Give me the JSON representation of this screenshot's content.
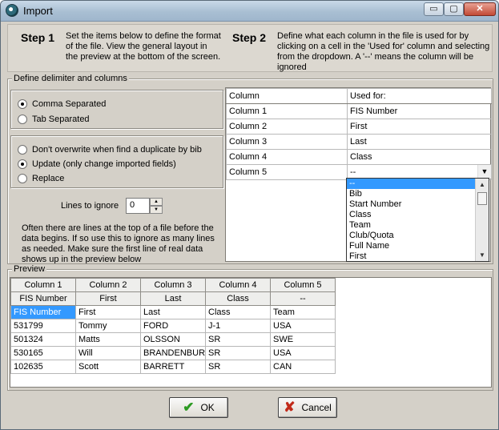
{
  "window": {
    "title": "Import"
  },
  "titlebar_controls": {
    "minimize": "▭",
    "maximize": "▢",
    "close": "✕"
  },
  "steps": {
    "step1_title": "Step 1",
    "step1_desc": "Set the items below to define the format of the file. View the general layout in the preview at the bottom of the screen.",
    "step2_title": "Step 2",
    "step2_desc": "Define what each column in the file is used for by clicking on a cell in the 'Used for' column and selecting from the dropdown. A '--' means the column will be ignored"
  },
  "delimiter": {
    "group_label": "Define delimiter and columns",
    "options": [
      {
        "label": "Comma Separated",
        "checked": true
      },
      {
        "label": "Tab Separated",
        "checked": false
      }
    ],
    "duplicate_options": [
      {
        "label": "Don't overwrite when find a duplicate by bib",
        "checked": false
      },
      {
        "label": "Update (only change imported fields)",
        "checked": true
      },
      {
        "label": "Replace",
        "checked": false
      }
    ],
    "lines_to_ignore_label": "Lines to ignore",
    "lines_to_ignore_value": "0",
    "help_text": "Often there are lines at the top of a file before the data begins. If so use this to ignore as many lines as needed. Make sure the first line of real data shows up in the preview below"
  },
  "mapping": {
    "headers": [
      "Column",
      "Used for:"
    ],
    "rows": [
      {
        "column": "Column 1",
        "used_for": "FIS Number"
      },
      {
        "column": "Column 2",
        "used_for": "First"
      },
      {
        "column": "Column 3",
        "used_for": "Last"
      },
      {
        "column": "Column 4",
        "used_for": "Class"
      },
      {
        "column": "Column 5",
        "used_for": "--"
      }
    ],
    "dropdown_options": [
      "--",
      "Bib",
      "Start Number",
      "Class",
      "Team",
      "Club/Quota",
      "Full Name",
      "First"
    ],
    "dropdown_selected": "--"
  },
  "preview": {
    "label": "Preview",
    "columns": [
      "Column 1",
      "Column 2",
      "Column 3",
      "Column 4",
      "Column 5"
    ],
    "mapped": [
      "FIS Number",
      "First",
      "Last",
      "Class",
      "--"
    ],
    "rows": [
      [
        "FIS Number",
        "First",
        "Last",
        "Class",
        "Team"
      ],
      [
        "531799",
        "Tommy",
        "FORD",
        "J-1",
        "USA"
      ],
      [
        "501324",
        "Matts",
        "OLSSON",
        "SR",
        "SWE"
      ],
      [
        "530165",
        "Will",
        "BRANDENBURG",
        "SR",
        "USA"
      ],
      [
        "102635",
        "Scott",
        "BARRETT",
        "SR",
        "CAN"
      ]
    ]
  },
  "buttons": {
    "ok": "OK",
    "cancel": "Cancel",
    "ok_icon": "✔",
    "cancel_icon": "✘"
  }
}
